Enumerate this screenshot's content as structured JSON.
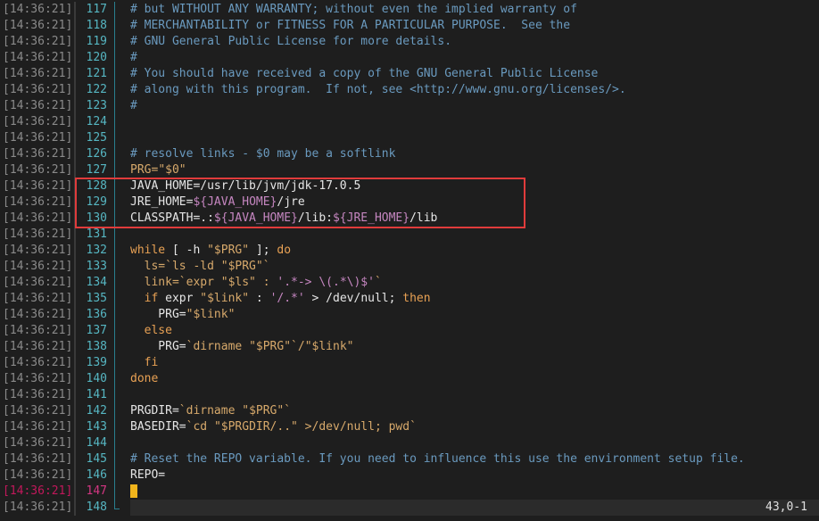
{
  "timestamp": "[14:36:21]",
  "lines": [
    {
      "n": "117",
      "segs": [
        {
          "t": "# but WITHOUT ANY WARRANTY; without even the implied warranty of",
          "c": "c"
        }
      ]
    },
    {
      "n": "118",
      "segs": [
        {
          "t": "# MERCHANTABILITY or FITNESS FOR A PARTICULAR PURPOSE.  See the",
          "c": "c"
        }
      ]
    },
    {
      "n": "119",
      "segs": [
        {
          "t": "# GNU General Public License for more details.",
          "c": "c"
        }
      ]
    },
    {
      "n": "120",
      "segs": [
        {
          "t": "#",
          "c": "c"
        }
      ]
    },
    {
      "n": "121",
      "segs": [
        {
          "t": "# You should have received a copy of the GNU General Public License",
          "c": "c"
        }
      ]
    },
    {
      "n": "122",
      "segs": [
        {
          "t": "# along with this program.  If not, see <http://www.gnu.org/licenses/>.",
          "c": "c"
        }
      ]
    },
    {
      "n": "123",
      "segs": [
        {
          "t": "#",
          "c": "c"
        }
      ]
    },
    {
      "n": "124",
      "segs": []
    },
    {
      "n": "125",
      "segs": []
    },
    {
      "n": "126",
      "segs": [
        {
          "t": "# resolve links - $0 may be a softlink",
          "c": "c"
        }
      ]
    },
    {
      "n": "127",
      "segs": [
        {
          "t": "PRG=",
          "c": "s"
        },
        {
          "t": "\"$0\"",
          "c": "s"
        }
      ]
    },
    {
      "n": "128",
      "segs": [
        {
          "t": "JAVA_HOME=/usr/lib/jvm/jdk-17.0.5",
          "c": "n"
        }
      ]
    },
    {
      "n": "129",
      "segs": [
        {
          "t": "JRE_HOME=",
          "c": "n"
        },
        {
          "t": "${JAVA_HOME}",
          "c": "v"
        },
        {
          "t": "/jre",
          "c": "n"
        }
      ]
    },
    {
      "n": "130",
      "segs": [
        {
          "t": "CLASSPATH=.:",
          "c": "n"
        },
        {
          "t": "${JAVA_HOME}",
          "c": "v"
        },
        {
          "t": "/lib:",
          "c": "n"
        },
        {
          "t": "${JRE_HOME}",
          "c": "v"
        },
        {
          "t": "/lib",
          "c": "n"
        }
      ]
    },
    {
      "n": "131",
      "segs": []
    },
    {
      "n": "132",
      "segs": [
        {
          "t": "while",
          "c": "k"
        },
        {
          "t": " [ -h ",
          "c": "n"
        },
        {
          "t": "\"$PRG\"",
          "c": "s"
        },
        {
          "t": " ]; ",
          "c": "n"
        },
        {
          "t": "do",
          "c": "k"
        }
      ]
    },
    {
      "n": "133",
      "segs": [
        {
          "t": "  ls=`ls -ld ",
          "c": "s"
        },
        {
          "t": "\"$PRG\"",
          "c": "s"
        },
        {
          "t": "`",
          "c": "s"
        }
      ]
    },
    {
      "n": "134",
      "segs": [
        {
          "t": "  link=`expr ",
          "c": "s"
        },
        {
          "t": "\"$ls\"",
          "c": "s"
        },
        {
          "t": " : ",
          "c": "s"
        },
        {
          "t": "'.*-> \\(.*\\)$'",
          "c": "v"
        },
        {
          "t": "`",
          "c": "s"
        }
      ]
    },
    {
      "n": "135",
      "segs": [
        {
          "t": "  if",
          "c": "k"
        },
        {
          "t": " expr ",
          "c": "n"
        },
        {
          "t": "\"$link\"",
          "c": "s"
        },
        {
          "t": " : ",
          "c": "n"
        },
        {
          "t": "'/.*'",
          "c": "v"
        },
        {
          "t": " > /dev/null; ",
          "c": "n"
        },
        {
          "t": "then",
          "c": "k"
        }
      ]
    },
    {
      "n": "136",
      "segs": [
        {
          "t": "    PRG=",
          "c": "n"
        },
        {
          "t": "\"$link\"",
          "c": "s"
        }
      ]
    },
    {
      "n": "137",
      "segs": [
        {
          "t": "  else",
          "c": "k"
        }
      ]
    },
    {
      "n": "138",
      "segs": [
        {
          "t": "    PRG=",
          "c": "n"
        },
        {
          "t": "`dirname ",
          "c": "s"
        },
        {
          "t": "\"$PRG\"",
          "c": "s"
        },
        {
          "t": "`/",
          "c": "s"
        },
        {
          "t": "\"$link\"",
          "c": "s"
        }
      ]
    },
    {
      "n": "139",
      "segs": [
        {
          "t": "  fi",
          "c": "k"
        }
      ]
    },
    {
      "n": "140",
      "segs": [
        {
          "t": "done",
          "c": "k"
        }
      ]
    },
    {
      "n": "141",
      "segs": []
    },
    {
      "n": "142",
      "segs": [
        {
          "t": "PRGDIR=",
          "c": "n"
        },
        {
          "t": "`dirname ",
          "c": "s"
        },
        {
          "t": "\"$PRG\"",
          "c": "s"
        },
        {
          "t": "`",
          "c": "s"
        }
      ]
    },
    {
      "n": "143",
      "segs": [
        {
          "t": "BASEDIR=",
          "c": "n"
        },
        {
          "t": "`cd ",
          "c": "s"
        },
        {
          "t": "\"$PRGDIR/..\"",
          "c": "s"
        },
        {
          "t": " >/dev/null; pwd`",
          "c": "s"
        }
      ]
    },
    {
      "n": "144",
      "segs": []
    },
    {
      "n": "145",
      "segs": [
        {
          "t": "# Reset the REPO variable. If you need to influence this use the environment setup file.",
          "c": "c"
        }
      ]
    },
    {
      "n": "146",
      "segs": [
        {
          "t": "REPO=",
          "c": "n"
        }
      ]
    },
    {
      "n": "147",
      "segs": [],
      "current": true
    },
    {
      "n": "148",
      "segs": []
    }
  ],
  "status": {
    "position": "43,0-1"
  },
  "colors": {
    "highlight_box": "#e03b3b",
    "cursor": "#f1b51c",
    "line_number": "#56b6c2"
  }
}
